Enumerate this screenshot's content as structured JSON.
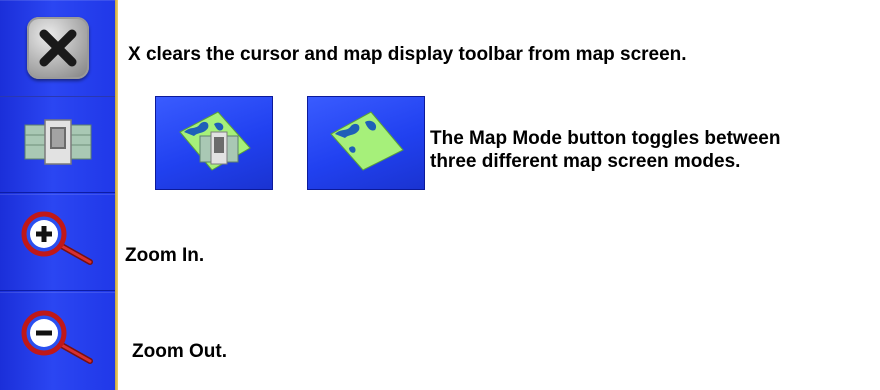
{
  "toolbar": {
    "buttons": [
      {
        "name": "close",
        "icon": "close-icon"
      },
      {
        "name": "map-mode",
        "icon": "map-mode-icon"
      },
      {
        "name": "zoom-in",
        "icon": "zoom-in-icon"
      },
      {
        "name": "zoom-out",
        "icon": "zoom-out-icon"
      }
    ],
    "colors": {
      "background": "#2b46f2",
      "edge": "#e5c25a"
    }
  },
  "descriptions": {
    "close": "X clears the cursor and map display toolbar from map screen.",
    "map_mode_line1": "The Map Mode button toggles between",
    "map_mode_line2": "three different map screen modes.",
    "zoom_in": "Zoom In.",
    "zoom_out": "Zoom Out."
  },
  "mode_previews": [
    {
      "icon": "map-with-guidance-icon"
    },
    {
      "icon": "map-only-icon"
    }
  ]
}
